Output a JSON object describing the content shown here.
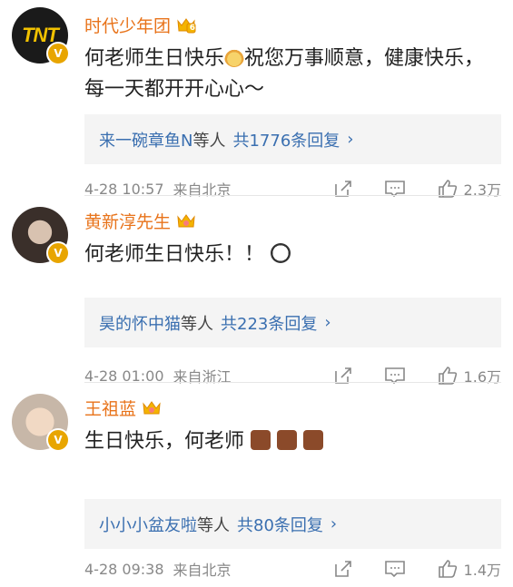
{
  "comments": [
    {
      "name": "时代少年团",
      "badge": "6",
      "avatar_text": "TNT",
      "text_before": "何老师生日快乐",
      "text_after": "祝您万事顺意，健康快乐，每一天都开开心心～",
      "reply_users": "来一碗章鱼N",
      "reply_etc": "等人",
      "reply_count": "共1776条回复",
      "date": "4-28 10:57",
      "location": "来自北京",
      "likes": "2.3万"
    },
    {
      "name": "黄新淳先生",
      "badge": "",
      "avatar_text": "",
      "text_before": "何老师生日快乐！！",
      "text_after": "",
      "reply_users": "昊的怀中猫",
      "reply_etc": "等人",
      "reply_count": "共223条回复",
      "date": "4-28 01:00",
      "location": "来自浙江",
      "likes": "1.6万"
    },
    {
      "name": "王祖蓝",
      "badge": "",
      "avatar_text": "",
      "text_before": "生日快乐，何老师",
      "text_after": "",
      "reply_users": "小小小盆友啦",
      "reply_etc": "等人",
      "reply_count": "共80条回复",
      "date": "4-28 09:38",
      "location": "来自北京",
      "likes": "1.4万"
    }
  ],
  "colors": {
    "name": "#e8731a",
    "link": "#3a6fb0",
    "meta": "#888888",
    "reply_bg": "#f4f4f4",
    "v_badge": "#e8a500"
  },
  "icons": {
    "verified": "v-badge-icon",
    "crown": "crown-icon",
    "share": "share-icon",
    "comment": "comment-icon",
    "like": "thumbs-up-icon",
    "chevron": "chevron-right-icon"
  }
}
